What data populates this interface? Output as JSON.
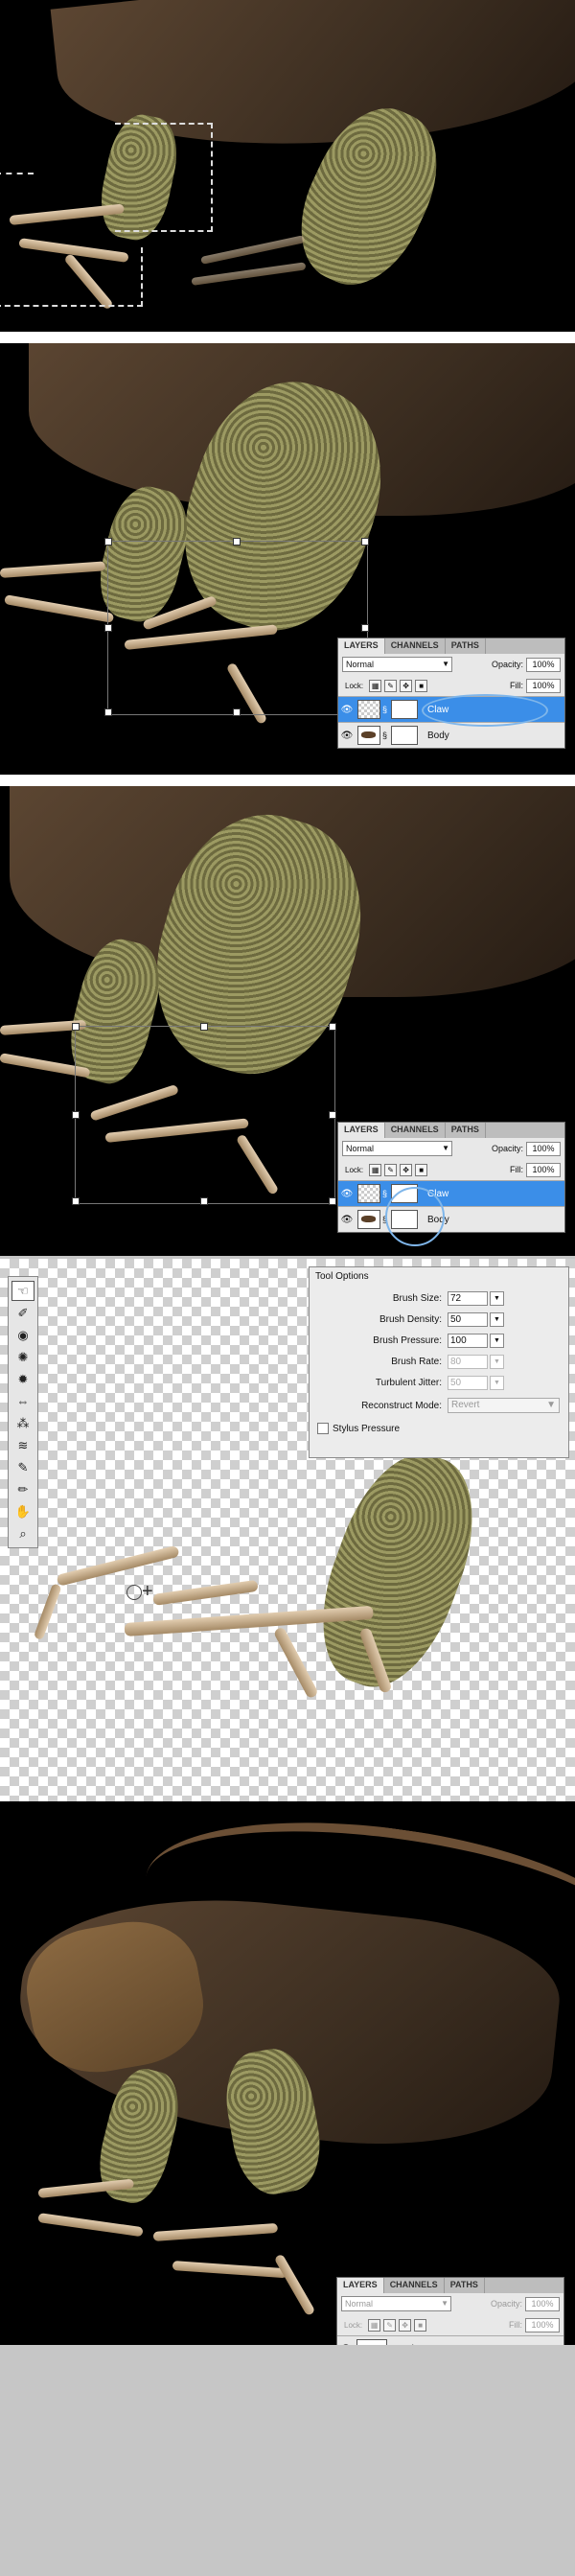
{
  "layers_panel": {
    "tabs": [
      "LAYERS",
      "CHANNELS",
      "PATHS"
    ],
    "blend_mode": "Normal",
    "opacity_label": "Opacity:",
    "opacity_value": "100%",
    "lock_label": "Lock:",
    "fill_label": "Fill:",
    "fill_value": "100%",
    "layer_claw": "Claw",
    "layer_body": "Body"
  },
  "tool_options": {
    "title": "Tool Options",
    "rows": [
      {
        "label": "Brush Size:",
        "value": "72",
        "enabled": true
      },
      {
        "label": "Brush Density:",
        "value": "50",
        "enabled": true
      },
      {
        "label": "Brush Pressure:",
        "value": "100",
        "enabled": true
      },
      {
        "label": "Brush Rate:",
        "value": "80",
        "enabled": false
      },
      {
        "label": "Turbulent Jitter:",
        "value": "50",
        "enabled": false
      }
    ],
    "reconstruct_label": "Reconstruct Mode:",
    "reconstruct_value": "Revert",
    "stylus_label": "Stylus Pressure"
  },
  "liquify_tools": [
    "forward-warp-icon",
    "reconstruct-icon",
    "twirl-icon",
    "pucker-icon",
    "bloat-icon",
    "push-left-icon",
    "mirror-icon",
    "turbulence-icon",
    "freeze-mask-icon",
    "thaw-mask-icon",
    "hand-icon",
    "zoom-icon"
  ],
  "colors": {
    "selection_blue": "#3b8ee8",
    "highlight_ring": "#7fb6ea",
    "background_grey": "#c6c6c6"
  }
}
